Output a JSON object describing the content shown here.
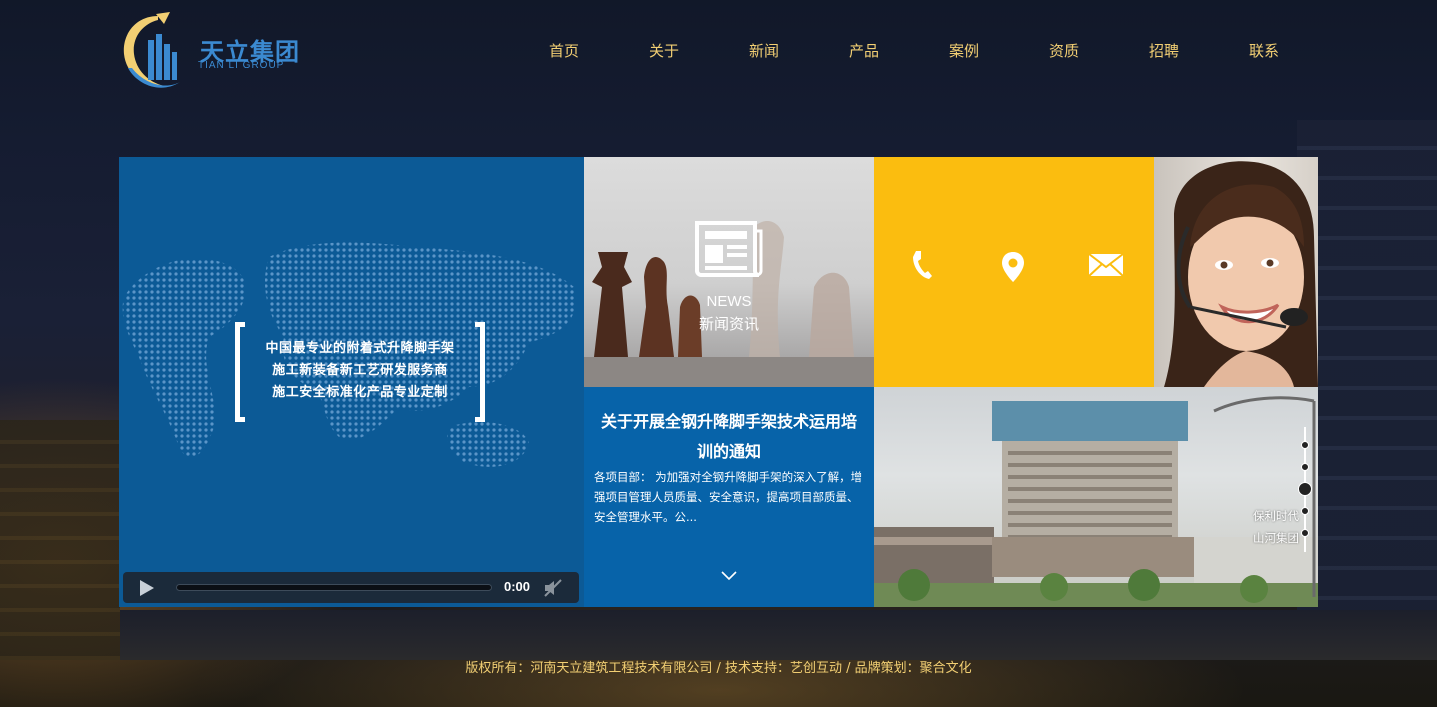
{
  "brand": {
    "name_cn": "天立集团",
    "name_en": "TIAN LI GROUP"
  },
  "nav": {
    "items": [
      "首页",
      "关于",
      "新闻",
      "产品",
      "案例",
      "资质",
      "招聘",
      "联系"
    ]
  },
  "video": {
    "slogan": [
      "中国最专业的附着式升降脚手架",
      "施工新装备新工艺研发服务商",
      "施工安全标准化产品专业定制"
    ],
    "time": "0:00"
  },
  "news": {
    "label_en": "NEWS",
    "label_cn": "新闻资讯",
    "headline": "关于开展全钢升降脚手架技术运用培训的通知",
    "summary": "各项目部： 为加强对全钢升降脚手架的深入了解，增强项目管理人员质量、安全意识，提高项目部质量、安全管理水平。公..."
  },
  "contact": {
    "icons": [
      "phone-icon",
      "location-icon",
      "mail-icon"
    ]
  },
  "cases": {
    "slides": [
      "保利时代",
      "山河集团"
    ]
  },
  "footer": {
    "copyright": "版权所有：河南天立建筑工程技术有限公司 / 技术支持：艺创互动 / 品牌策划：聚合文化"
  },
  "colors": {
    "nav_text": "#f2cf73",
    "brand_blue": "#0763a9",
    "accent_yellow": "#fbbd0f",
    "logo_blue": "#3b8ad1"
  }
}
